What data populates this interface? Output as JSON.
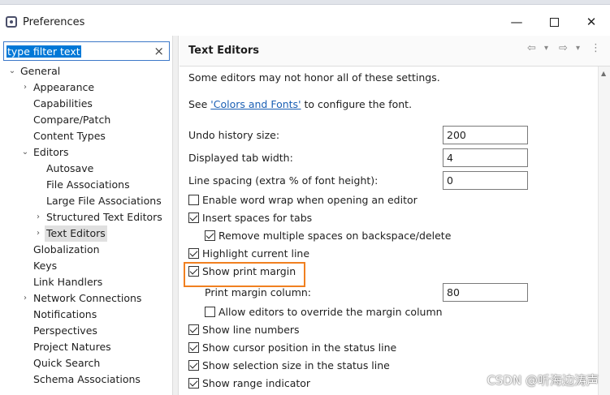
{
  "window": {
    "title": "Preferences",
    "controls": {
      "minimize": "—",
      "close": "✕"
    }
  },
  "filter": {
    "value": "type filter text",
    "clear": "×"
  },
  "tree": [
    {
      "label": "General",
      "twisty": "⌄"
    },
    {
      "label": "Appearance",
      "twisty": "›"
    },
    {
      "label": "Capabilities"
    },
    {
      "label": "Compare/Patch"
    },
    {
      "label": "Content Types"
    },
    {
      "label": "Editors",
      "twisty": "⌄"
    },
    {
      "label": "Autosave"
    },
    {
      "label": "File Associations"
    },
    {
      "label": "Large File Associations"
    },
    {
      "label": "Structured Text Editors",
      "twisty": "›"
    },
    {
      "label": "Text Editors",
      "twisty": "›",
      "selected": true
    },
    {
      "label": "Globalization"
    },
    {
      "label": "Keys"
    },
    {
      "label": "Link Handlers"
    },
    {
      "label": "Network Connections",
      "twisty": "›"
    },
    {
      "label": "Notifications"
    },
    {
      "label": "Perspectives"
    },
    {
      "label": "Project Natures"
    },
    {
      "label": "Quick Search"
    },
    {
      "label": "Schema Associations"
    }
  ],
  "panel": {
    "title": "Text Editors",
    "nav": {
      "back": "⇦",
      "back_menu": "▾",
      "forward": "⇨",
      "forward_menu": "▾",
      "more": "⋮"
    },
    "note": "Some editors may not honor all of these settings.",
    "font_prefix": "See ",
    "font_link": "'Colors and Fonts'",
    "font_suffix": " to configure the font.",
    "fields": {
      "undo_label": "Undo history size:",
      "undo_value": "200",
      "tab_label": "Displayed tab width:",
      "tab_value": "4",
      "spacing_label": "Line spacing (extra % of font height):",
      "spacing_value": "0",
      "margin_label": "Print margin column:",
      "margin_value": "80"
    },
    "checks": {
      "word_wrap": {
        "label": "Enable word wrap when opening an editor",
        "checked": false
      },
      "insert_spaces": {
        "label": "Insert spaces for tabs",
        "checked": true
      },
      "remove_spaces": {
        "label": "Remove multiple spaces on backspace/delete",
        "checked": true
      },
      "highlight_line": {
        "label": "Highlight current line",
        "checked": true
      },
      "print_margin": {
        "label": "Show print margin",
        "checked": true
      },
      "override_margin": {
        "label": "Allow editors to override the margin column",
        "checked": false
      },
      "line_numbers": {
        "label": "Show line numbers",
        "checked": true
      },
      "cursor_position": {
        "label": "Show cursor position in the status line",
        "checked": true
      },
      "selection_size": {
        "label": "Show selection size in the status line",
        "checked": true
      },
      "range_indicator": {
        "label": "Show range indicator",
        "checked": true
      }
    }
  },
  "watermark": "CSDN @听海边涛声",
  "colors": {
    "highlight": "#f08020",
    "link": "#1a5fb4",
    "selection": "#0078d7"
  }
}
